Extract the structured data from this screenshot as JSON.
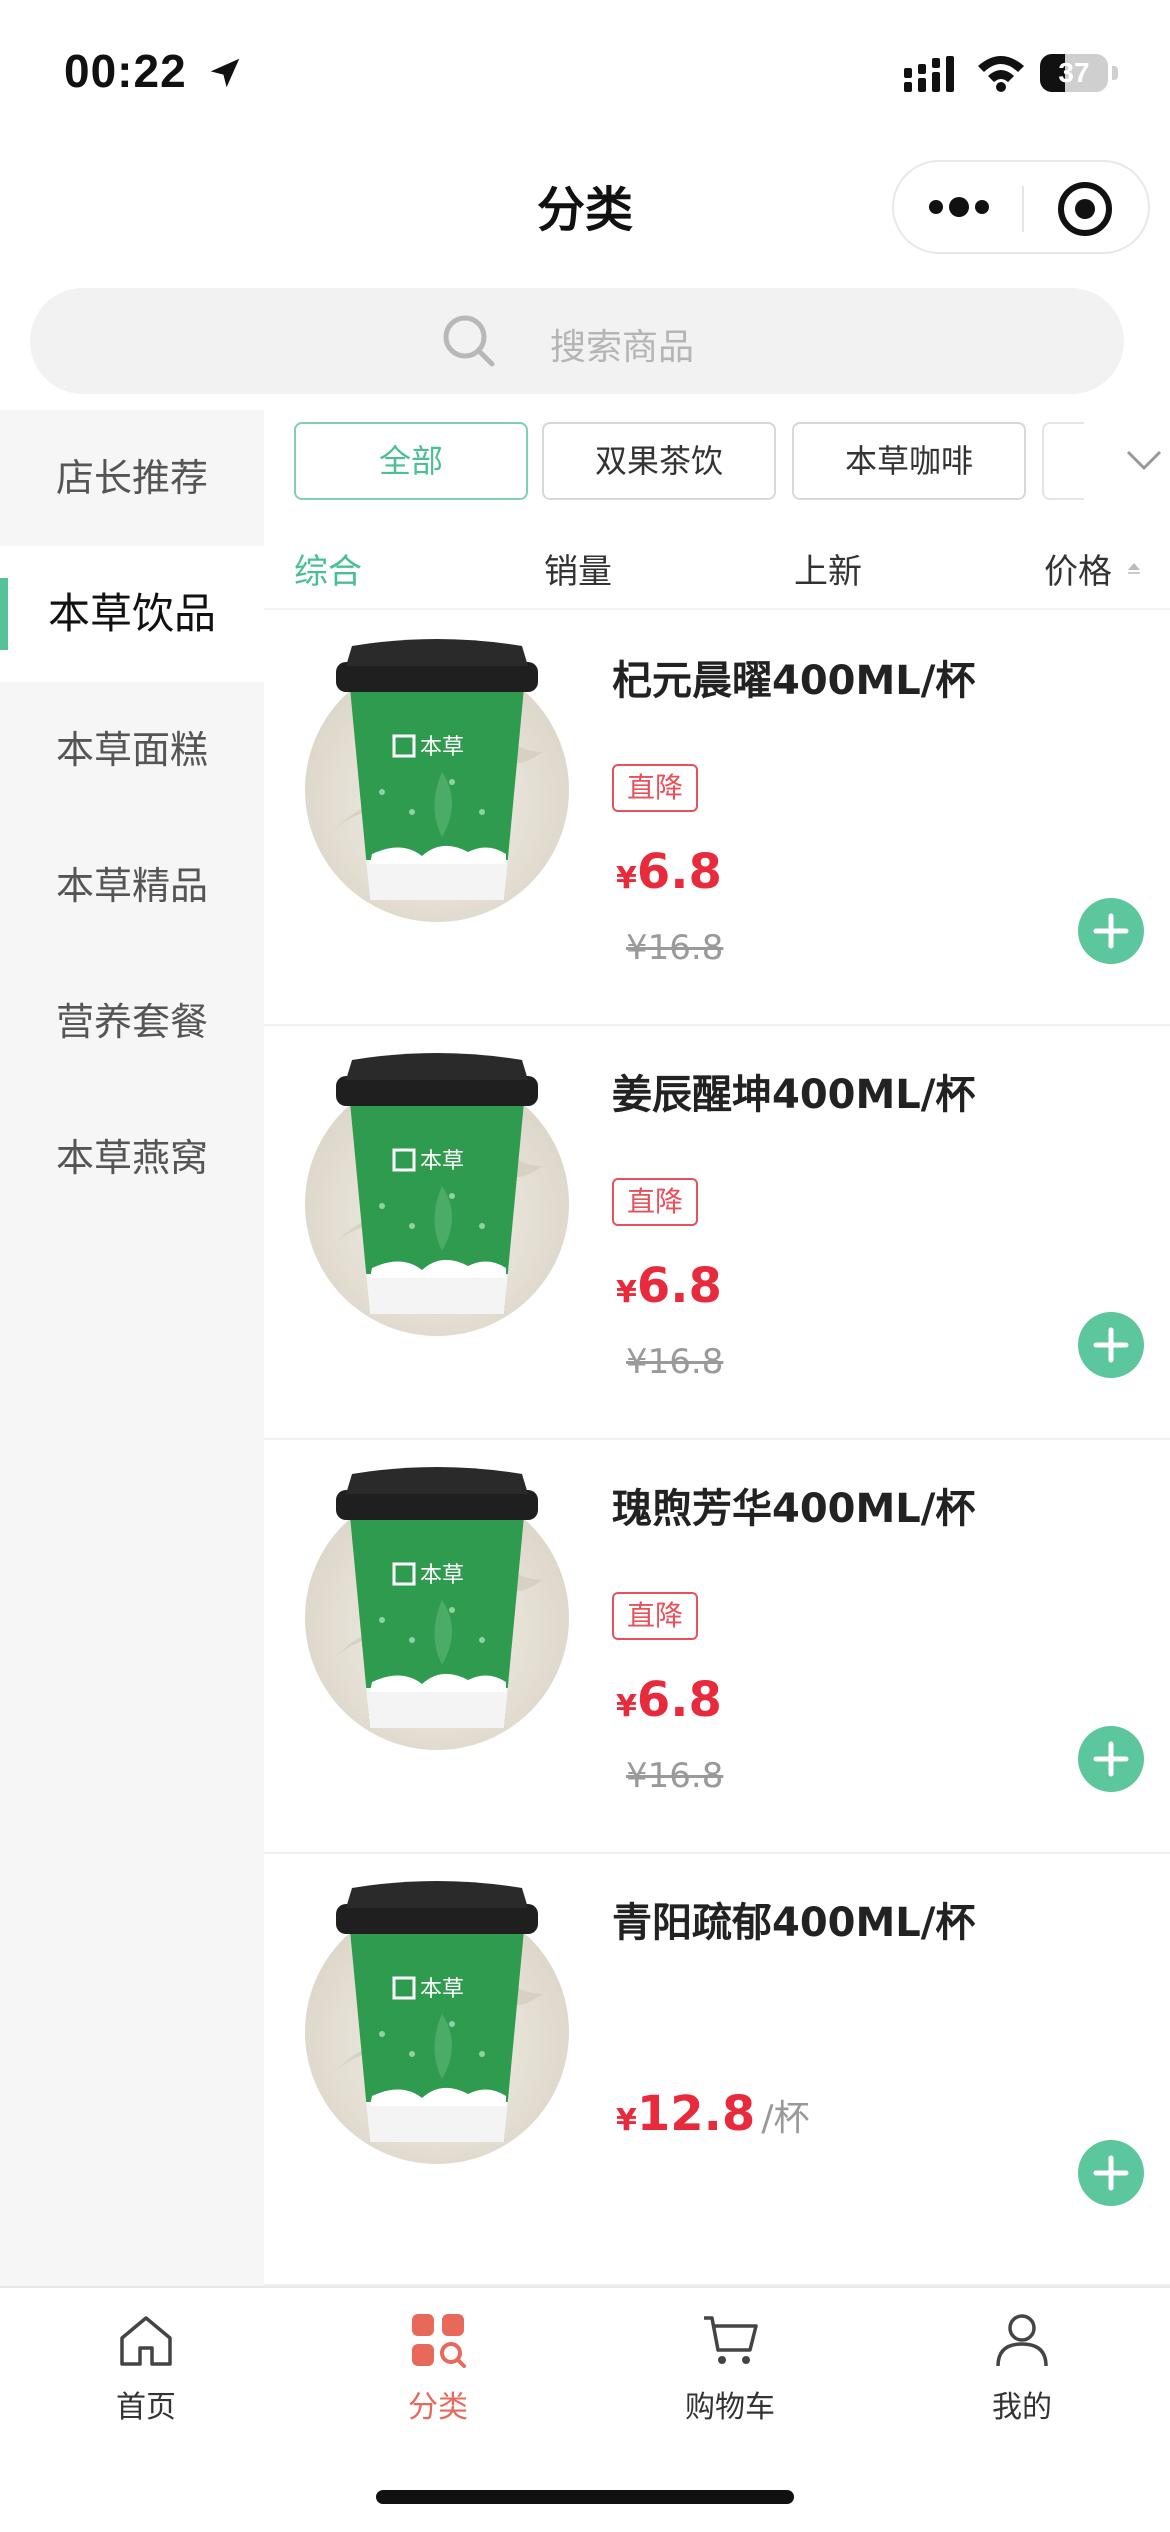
{
  "status_bar": {
    "time": "00:22",
    "battery": "37",
    "battery_level": 0.37
  },
  "header": {
    "title": "分类"
  },
  "search": {
    "placeholder": "搜索商品"
  },
  "sidebar": {
    "items": [
      {
        "label": "店长推荐",
        "active": false
      },
      {
        "label": "本草饮品",
        "active": true
      },
      {
        "label": "本草面糕",
        "active": false
      },
      {
        "label": "本草精品",
        "active": false
      },
      {
        "label": "营养套餐",
        "active": false
      },
      {
        "label": "本草燕窝",
        "active": false
      }
    ]
  },
  "filters": {
    "chips": [
      {
        "label": "全部",
        "active": true
      },
      {
        "label": "双果茶饮",
        "active": false
      },
      {
        "label": "本草咖啡",
        "active": false
      }
    ]
  },
  "sort": {
    "options": [
      {
        "label": "综合",
        "active": true
      },
      {
        "label": "销量",
        "active": false
      },
      {
        "label": "上新",
        "active": false
      },
      {
        "label": "价格",
        "active": false
      }
    ]
  },
  "products": [
    {
      "name": "杞元晨曜400ML/杯",
      "badge": "直降",
      "currency": "¥",
      "price": "6.8",
      "unit": "",
      "old_price": "¥16.8"
    },
    {
      "name": "姜辰醒坤400ML/杯",
      "badge": "直降",
      "currency": "¥",
      "price": "6.8",
      "unit": "",
      "old_price": "¥16.8"
    },
    {
      "name": "瑰煦芳华400ML/杯",
      "badge": "直降",
      "currency": "¥",
      "price": "6.8",
      "unit": "",
      "old_price": "¥16.8"
    },
    {
      "name": "青阳疏郁400ML/杯",
      "badge": "",
      "currency": "¥",
      "price": "12.8",
      "unit": "/杯",
      "old_price": ""
    }
  ],
  "tabbar": {
    "items": [
      {
        "label": "首页",
        "icon": "home-icon",
        "active": false
      },
      {
        "label": "分类",
        "icon": "category-icon",
        "active": true
      },
      {
        "label": "购物车",
        "icon": "cart-icon",
        "active": false
      },
      {
        "label": "我的",
        "icon": "profile-icon",
        "active": false
      }
    ]
  },
  "colors": {
    "accent": "#4bbf93",
    "price": "#e82b3c",
    "tab_active": "#e8685a",
    "add_button": "#5cc79d"
  }
}
